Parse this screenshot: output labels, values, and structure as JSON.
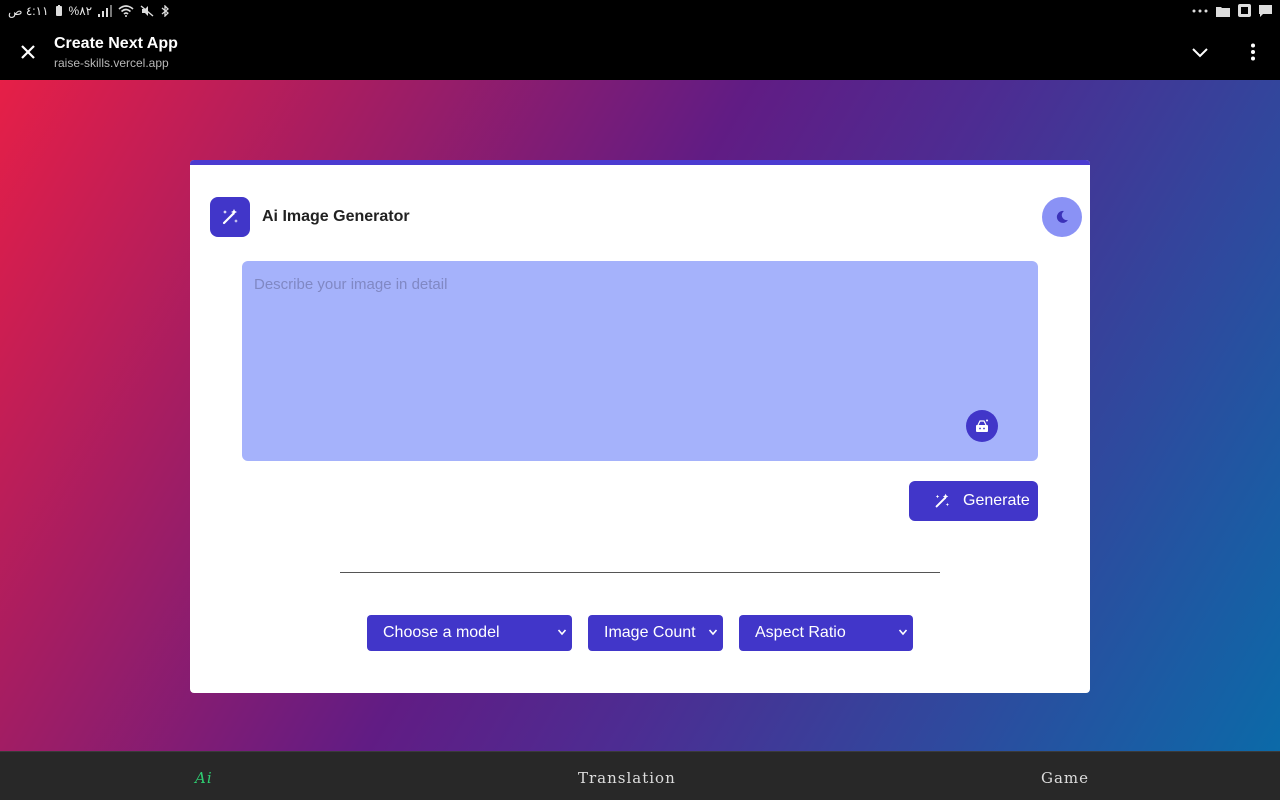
{
  "status_bar": {
    "time": "٤:١١ ص",
    "battery": "%٨٢",
    "icons": [
      "battery-icon",
      "signal-icon",
      "wifi-icon",
      "mute-icon",
      "bluetooth-icon",
      "more-icon",
      "folder-icon",
      "app-icon",
      "chat-icon"
    ]
  },
  "toolbar": {
    "title": "Create Next App",
    "url": "raise-skills.vercel.app",
    "icons": [
      "close-icon",
      "chevron-down-icon",
      "more-vert-icon"
    ]
  },
  "app": {
    "title": "Ai Image Generator",
    "prompt_placeholder": "Describe your image in detail",
    "prompt_value": "",
    "generate_label": "Generate",
    "model_select": "Choose a model",
    "count_select": "Image Count",
    "ratio_select": "Aspect Ratio",
    "icons": [
      "magic-wand-icon",
      "moon-icon",
      "dice-icon"
    ]
  },
  "bottom_nav": {
    "items": [
      {
        "label": "Ai",
        "active": true
      },
      {
        "label": "Translation",
        "active": false
      },
      {
        "label": "Game",
        "active": false
      }
    ]
  },
  "colors": {
    "accent": "#4136c9",
    "prompt_bg": "#a5b2fb",
    "toggle_bg": "#8a92f5",
    "active_nav": "#2ecc71"
  }
}
